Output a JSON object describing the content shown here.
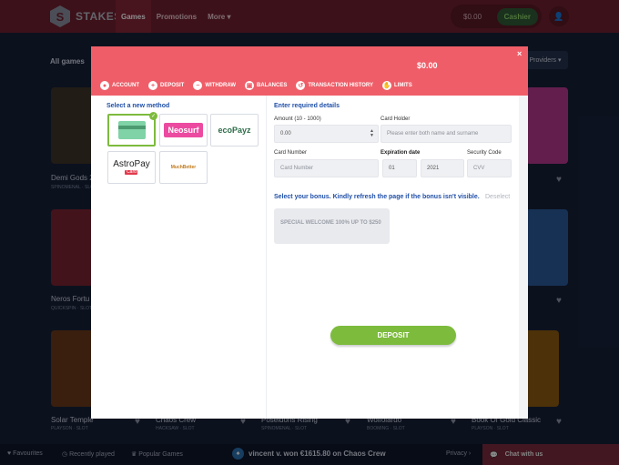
{
  "header": {
    "logo": "STAKES",
    "nav": [
      "Games",
      "Promotions",
      "More"
    ],
    "balance": "$0.00",
    "cashier": "Cashier"
  },
  "lobby": {
    "section": "All games",
    "providers": "Providers",
    "games": [
      {
        "name": "Demi Gods 2",
        "sub": "SPINOMENAL · SLOT"
      },
      {
        "name": "Neros Fortu",
        "sub": "QUICKSPIN · SLOT"
      },
      {
        "name": "Solar Temple",
        "sub": "PLAYSON · SLOT"
      },
      {
        "name": "Chaos Crew",
        "sub": "HACKSAW · SLOT"
      },
      {
        "name": "Poseidons Rising",
        "sub": "SPINOMENAL · SLOT"
      },
      {
        "name": "Wolfolardo",
        "sub": "BOOMING · SLOT"
      },
      {
        "name": "Book Of Gold Classic",
        "sub": "PLAYSON · SLOT"
      }
    ]
  },
  "bottom": {
    "favourites": "Favourites",
    "recent": "Recently played",
    "popular": "Popular Games",
    "winner": "vincent v. won €1615.80 on Chaos Crew",
    "privacy": "Privacy",
    "chat": "Chat with us"
  },
  "modal": {
    "balance": "$0.00",
    "close": "×",
    "tabs": [
      "ACCOUNT",
      "DEPOSIT",
      "WITHDRAW",
      "BALANCES",
      "TRANSACTION HISTORY",
      "LIMITS"
    ],
    "select_method": "Select a new method",
    "methods": [
      "Neosurf",
      "ecoPayz",
      "AstroPay",
      "Card",
      "MuchBetter"
    ],
    "enter_details": "Enter required details",
    "amount_label": "Amount (10 - 1000)",
    "amount_value": "0.00",
    "holder_label": "Card Holder",
    "holder_placeholder": "Please enter both name and surname",
    "number_label": "Card Number",
    "number_placeholder": "Card Number",
    "expiry_label": "Expiration date",
    "expiry_month": "01",
    "expiry_year": "2021",
    "cvv_label": "Security Code",
    "cvv_placeholder": "CVV",
    "bonus_question": "Select your bonus. Kindly refresh the page if the bonus isn't visible.",
    "deselect": "Deselect",
    "bonus_name": "SPECIAL WELCOME 100% UP TO $250",
    "deposit_button": "DEPOSIT"
  },
  "colors": {
    "modal_header": "#ef5e68",
    "accent_green": "#7dbb3d",
    "link_blue": "#1f4fa8",
    "topbar": "#6e1f30"
  }
}
